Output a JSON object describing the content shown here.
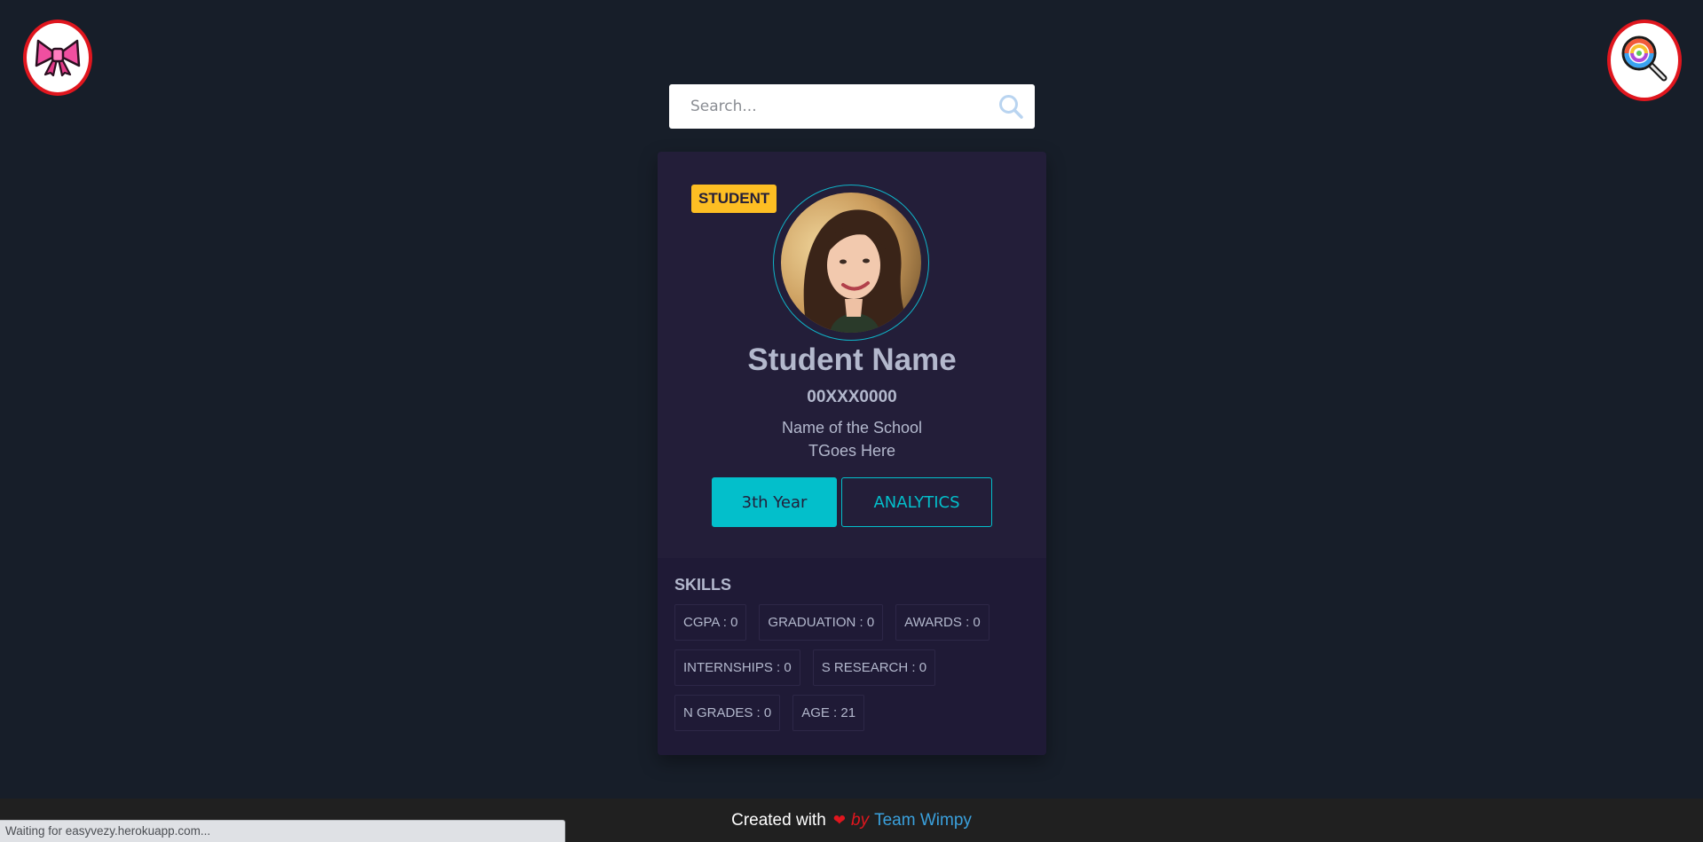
{
  "corner_buttons": {
    "left_icon": "ribbon-bow-icon",
    "right_icon": "lollipop-magnifier-icon"
  },
  "search": {
    "placeholder": "Search...",
    "value": ""
  },
  "profile_card": {
    "badge": "STUDENT",
    "name": "Student Name",
    "id": "00XXX0000",
    "school_line1": "Name of the School",
    "school_line2": "TGoes Here",
    "year_button": "3th Year",
    "analytics_button": "ANALYTICS"
  },
  "skills": {
    "title": "SKILLS",
    "items": [
      "CGPA : 0",
      "GRADUATION : 0",
      "AWARDS : 0",
      "INTERNSHIPS : 0",
      "S RESEARCH : 0",
      "N GRADES : 0",
      "AGE : 21"
    ]
  },
  "footer": {
    "created_with": "Created with",
    "heart": "❤",
    "by": "by",
    "team": "Team Wimpy"
  },
  "status_bar": {
    "text": "Waiting for easyvezy.herokuapp.com..."
  },
  "colors": {
    "background": "#171e29",
    "card": "#231e39",
    "accent": "#03bfcb",
    "badge": "#fdbe23",
    "corner_border": "#e0161e"
  }
}
